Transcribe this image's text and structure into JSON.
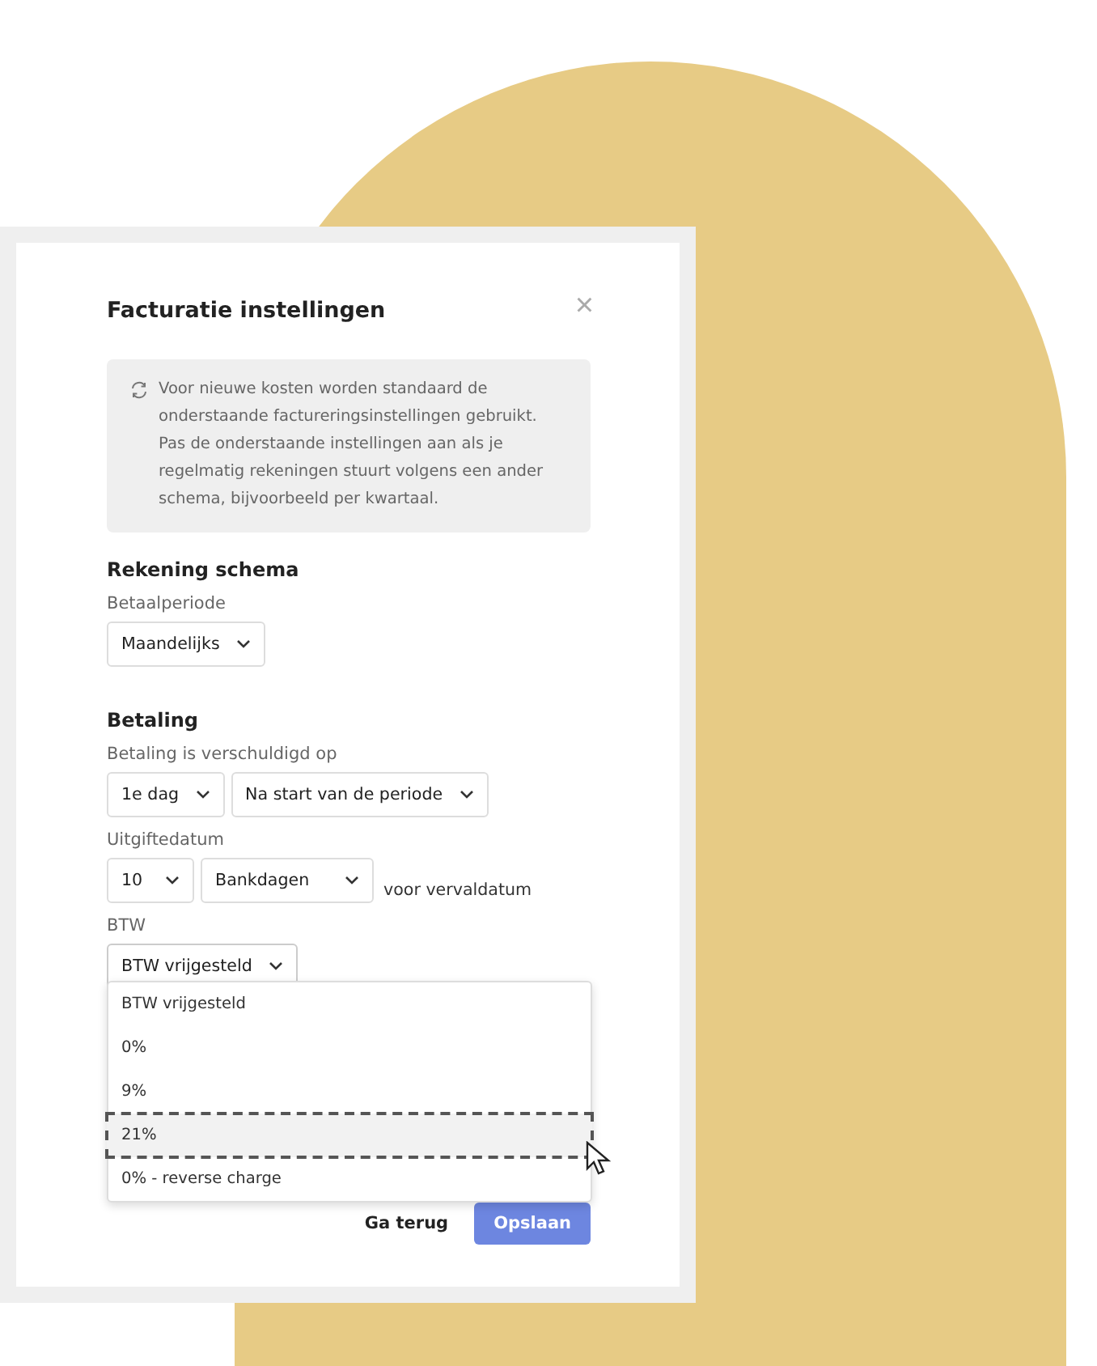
{
  "dialog": {
    "title": "Facturatie instellingen",
    "close": "×",
    "info": "Voor nieuwe kosten worden standaard de onderstaande factureringsinstellingen gebruikt. Pas de onderstaande instellingen aan als je regelmatig rekeningen stuurt volgens een ander schema, bijvoorbeeld per kwartaal."
  },
  "sections": [
    {
      "heading": "Rekening schema",
      "fields": [
        {
          "label": "Betaalperiode",
          "selects": [
            "Maandelijks"
          ]
        }
      ]
    },
    {
      "heading": "Betaling",
      "fields": [
        {
          "label": "Betaling is verschuldigd op",
          "selects": [
            "1e dag",
            "Na start van de periode"
          ]
        },
        {
          "label": "Uitgiftedatum",
          "selects": [
            "10",
            "Bankdagen"
          ],
          "suffix": "voor vervaldatum"
        },
        {
          "label": "BTW",
          "selects": [
            "BTW vrijgesteld"
          ],
          "open": true
        }
      ]
    }
  ],
  "dropdown_options": [
    {
      "label": "BTW vrijgesteld",
      "selected": false
    },
    {
      "label": "0%",
      "selected": false
    },
    {
      "label": "9%",
      "selected": false
    },
    {
      "label": "21%",
      "selected": true
    },
    {
      "label": "0% - reverse charge",
      "selected": false
    }
  ],
  "buttons": [
    {
      "label": "Ga terug",
      "kind": "secondary"
    },
    {
      "label": "Opslaan",
      "kind": "primary"
    }
  ]
}
